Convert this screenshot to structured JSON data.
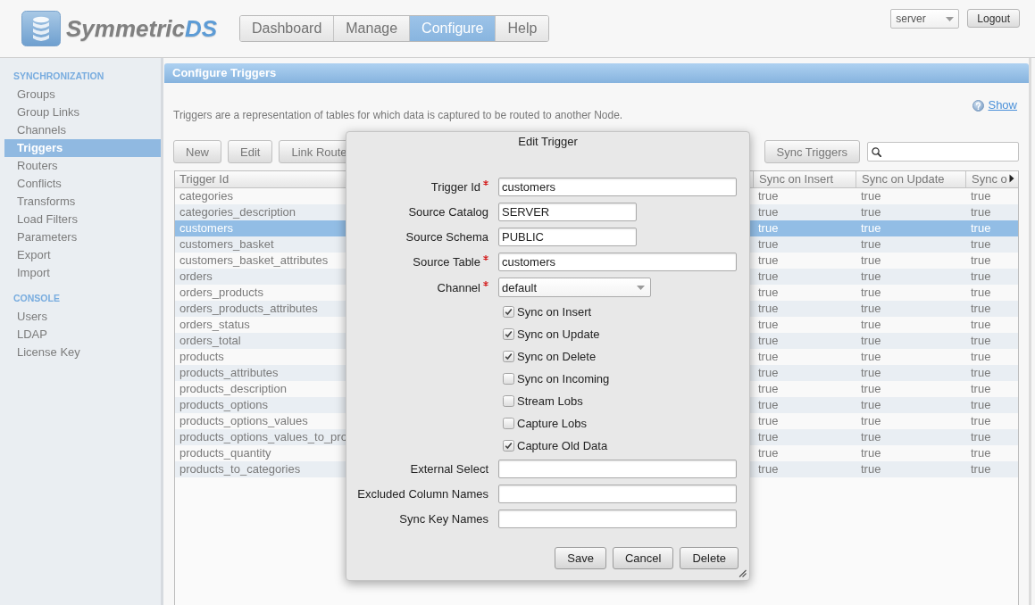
{
  "header": {
    "logo": {
      "name": "Symmetric",
      "accent": "DS"
    },
    "nav_tabs": [
      {
        "label": "Dashboard",
        "selected": false
      },
      {
        "label": "Manage",
        "selected": false
      },
      {
        "label": "Configure",
        "selected": true
      },
      {
        "label": "Help",
        "selected": false
      }
    ],
    "node_select": {
      "value": "server"
    },
    "logout_button": "Logout"
  },
  "sidebar": {
    "sections": [
      {
        "title": "SYNCHRONIZATION",
        "items": [
          {
            "label": "Groups",
            "selected": false
          },
          {
            "label": "Group Links",
            "selected": false
          },
          {
            "label": "Channels",
            "selected": false
          },
          {
            "label": "Triggers",
            "selected": true
          },
          {
            "label": "Routers",
            "selected": false
          },
          {
            "label": "Conflicts",
            "selected": false
          },
          {
            "label": "Transforms",
            "selected": false
          },
          {
            "label": "Load Filters",
            "selected": false
          },
          {
            "label": "Parameters",
            "selected": false
          },
          {
            "label": "Export",
            "selected": false
          },
          {
            "label": "Import",
            "selected": false
          }
        ]
      },
      {
        "title": "CONSOLE",
        "items": [
          {
            "label": "Users",
            "selected": false
          },
          {
            "label": "LDAP",
            "selected": false
          },
          {
            "label": "License Key",
            "selected": false
          }
        ]
      }
    ]
  },
  "main": {
    "title": "Configure Triggers",
    "help_link": "Show",
    "description": "Triggers are a representation of tables for which data is captured to be routed to another Node.",
    "toolbar": {
      "buttons": [
        "New",
        "Edit",
        "Link Route"
      ],
      "sync_button": "Sync Triggers"
    },
    "table": {
      "columns": [
        "Trigger Id",
        "Sync on Insert",
        "Sync on Update",
        "Sync o"
      ],
      "rows": [
        {
          "cells": [
            "categories",
            "true",
            "true",
            "true"
          ],
          "selected": false
        },
        {
          "cells": [
            "categories_description",
            "true",
            "true",
            "true"
          ],
          "selected": false
        },
        {
          "cells": [
            "customers",
            "true",
            "true",
            "true"
          ],
          "selected": true
        },
        {
          "cells": [
            "customers_basket",
            "true",
            "true",
            "true"
          ],
          "selected": false
        },
        {
          "cells": [
            "customers_basket_attributes",
            "true",
            "true",
            "true"
          ],
          "selected": false
        },
        {
          "cells": [
            "orders",
            "true",
            "true",
            "true"
          ],
          "selected": false
        },
        {
          "cells": [
            "orders_products",
            "true",
            "true",
            "true"
          ],
          "selected": false
        },
        {
          "cells": [
            "orders_products_attributes",
            "true",
            "true",
            "true"
          ],
          "selected": false
        },
        {
          "cells": [
            "orders_status",
            "true",
            "true",
            "true"
          ],
          "selected": false
        },
        {
          "cells": [
            "orders_total",
            "true",
            "true",
            "true"
          ],
          "selected": false
        },
        {
          "cells": [
            "products",
            "true",
            "true",
            "true"
          ],
          "selected": false
        },
        {
          "cells": [
            "products_attributes",
            "true",
            "true",
            "true"
          ],
          "selected": false
        },
        {
          "cells": [
            "products_description",
            "true",
            "true",
            "true"
          ],
          "selected": false
        },
        {
          "cells": [
            "products_options",
            "true",
            "true",
            "true"
          ],
          "selected": false
        },
        {
          "cells": [
            "products_options_values",
            "true",
            "true",
            "true"
          ],
          "selected": false
        },
        {
          "cells": [
            "products_options_values_to_pro",
            "true",
            "true",
            "true"
          ],
          "selected": false
        },
        {
          "cells": [
            "products_quantity",
            "true",
            "true",
            "true"
          ],
          "selected": false
        },
        {
          "cells": [
            "products_to_categories",
            "true",
            "true",
            "true"
          ],
          "selected": false
        }
      ]
    }
  },
  "dialog": {
    "title": "Edit Trigger",
    "fields": [
      {
        "label": "Trigger Id",
        "required": true,
        "kind": "text",
        "value": "customers"
      },
      {
        "label": "Source Catalog",
        "required": false,
        "kind": "short",
        "value": "SERVER"
      },
      {
        "label": "Source Schema",
        "required": false,
        "kind": "short",
        "value": "PUBLIC"
      },
      {
        "label": "Source Table",
        "required": true,
        "kind": "text",
        "value": "customers"
      },
      {
        "label": "Channel",
        "required": true,
        "kind": "select",
        "value": "default"
      }
    ],
    "checkboxes": [
      {
        "label": "Sync on Insert",
        "checked": true
      },
      {
        "label": "Sync on Update",
        "checked": true
      },
      {
        "label": "Sync on Delete",
        "checked": true
      },
      {
        "label": "Sync on Incoming",
        "checked": false
      },
      {
        "label": "Stream Lobs",
        "checked": false
      },
      {
        "label": "Capture Lobs",
        "checked": false
      },
      {
        "label": "Capture Old Data",
        "checked": true
      }
    ],
    "extra_fields": [
      {
        "label": "External Select"
      },
      {
        "label": "Excluded Column Names"
      },
      {
        "label": "Sync Key Names"
      }
    ],
    "buttons": [
      "Save",
      "Cancel",
      "Delete"
    ]
  }
}
